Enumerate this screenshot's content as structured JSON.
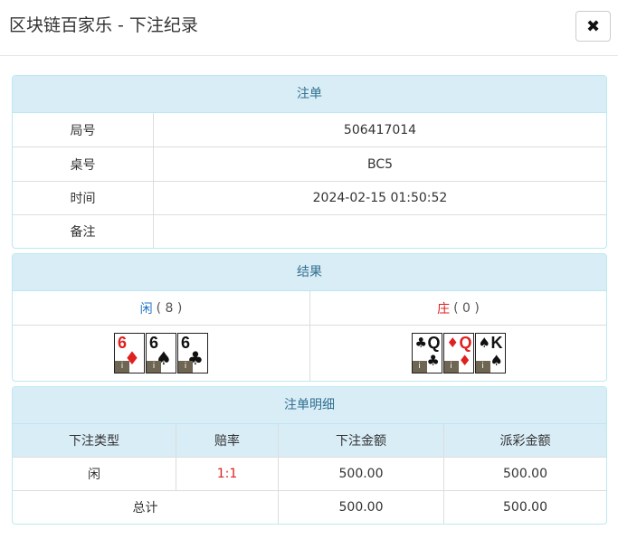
{
  "header": {
    "title": "区块链百家乐 - 下注纪录",
    "close_icon": "✖"
  },
  "order": {
    "heading": "注单",
    "rows": [
      {
        "label": "局号",
        "value": "506417014"
      },
      {
        "label": "桌号",
        "value": "BC5"
      },
      {
        "label": "时间",
        "value": "2024-02-15 01:50:52"
      },
      {
        "label": "备注",
        "value": ""
      }
    ]
  },
  "result": {
    "heading": "结果",
    "player": {
      "name": "闲",
      "score": "( 8 )",
      "cards": [
        {
          "rank": "6",
          "suit": "♦",
          "color": "red",
          "tag": "i"
        },
        {
          "rank": "6",
          "suit": "♠",
          "color": "black",
          "tag": "i"
        },
        {
          "rank": "6",
          "suit": "♣",
          "color": "black",
          "tag": "i"
        }
      ]
    },
    "banker": {
      "name": "庄",
      "score": "( 0 )",
      "cards": [
        {
          "rank": "Q",
          "suit": "♣",
          "color": "black",
          "tag": "i"
        },
        {
          "rank": "Q",
          "suit": "♦",
          "color": "red",
          "tag": "i"
        },
        {
          "rank": "K",
          "suit": "♠",
          "color": "black",
          "tag": "i"
        }
      ]
    }
  },
  "detail": {
    "heading": "注单明细",
    "columns": [
      "下注类型",
      "赔率",
      "下注金额",
      "派彩金额"
    ],
    "row": {
      "type": "闲",
      "odds": "1:1",
      "bet": "500.00",
      "payout": "500.00"
    },
    "total": {
      "label": "总计",
      "bet": "500.00",
      "payout": "500.00"
    }
  }
}
